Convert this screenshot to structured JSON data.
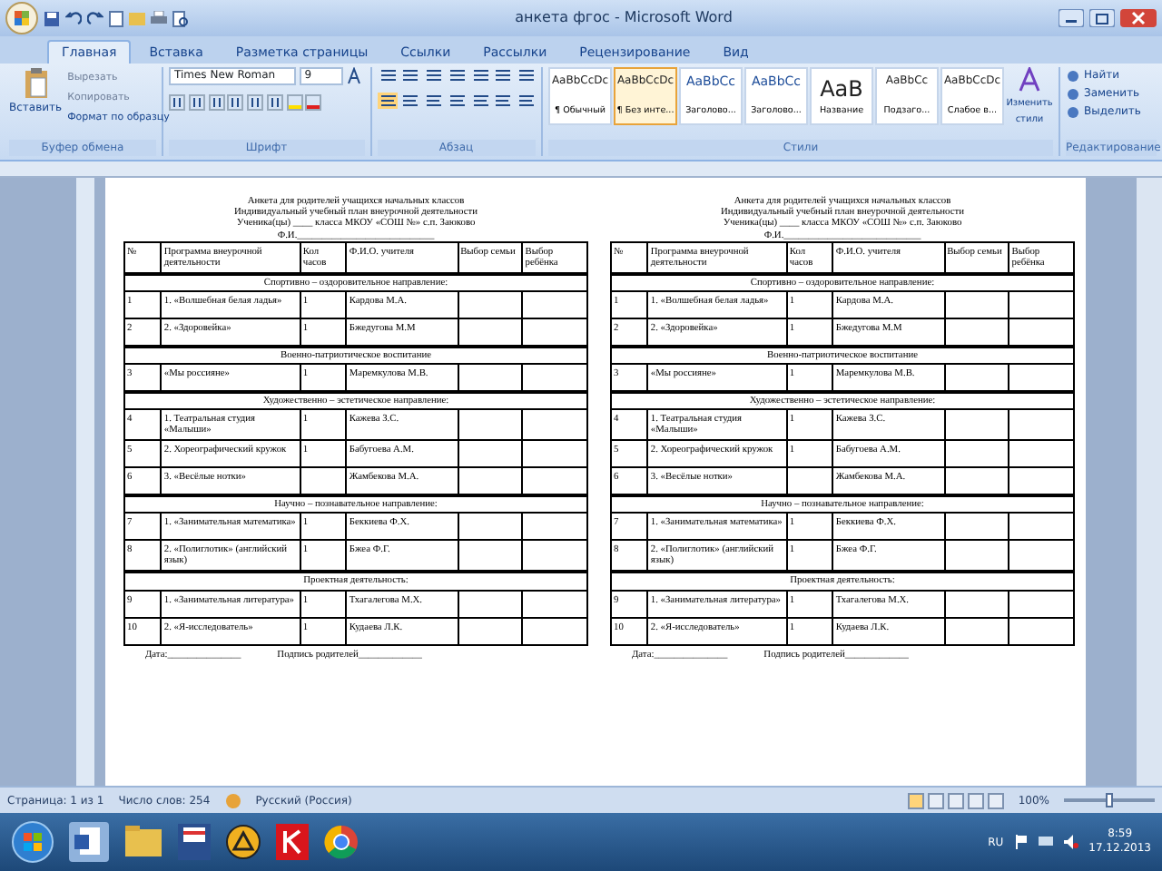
{
  "window": {
    "title": "анкета фгос - Microsoft Word"
  },
  "tabs": [
    {
      "label": "Главная",
      "selected": true
    },
    {
      "label": "Вставка",
      "selected": false
    },
    {
      "label": "Разметка страницы",
      "selected": false
    },
    {
      "label": "Ссылки",
      "selected": false
    },
    {
      "label": "Рассылки",
      "selected": false
    },
    {
      "label": "Рецензирование",
      "selected": false
    },
    {
      "label": "Вид",
      "selected": false
    }
  ],
  "ribbon": {
    "clipboard": {
      "paste": "Вставить",
      "items": [
        {
          "label": "Вырезать",
          "disabled": true
        },
        {
          "label": "Копировать",
          "disabled": true
        },
        {
          "label": "Формат по образцу",
          "disabled": false
        }
      ],
      "label": "Буфер обмена"
    },
    "font": {
      "name": "Times New Roman",
      "size": "9",
      "label": "Шрифт"
    },
    "paragraph": {
      "label": "Абзац"
    },
    "styles": {
      "items": [
        {
          "sample": "AaBbCcDc",
          "name": "¶ Обычный",
          "selected": false
        },
        {
          "sample": "AaBbCcDc",
          "name": "¶ Без инте...",
          "selected": true
        },
        {
          "sample": "AaBbCc",
          "name": "Заголово...",
          "selected": false
        },
        {
          "sample": "AaBbCc",
          "name": "Заголово...",
          "selected": false
        },
        {
          "sample": "АаВ",
          "name": "Название",
          "selected": false
        },
        {
          "sample": "AaBbCc",
          "name": "Подзаго...",
          "selected": false
        },
        {
          "sample": "AaBbCcDc",
          "name": "Слабое в...",
          "selected": false
        }
      ],
      "change": "Изменить стили",
      "label": "Стили"
    },
    "editing": {
      "items": [
        "Найти",
        "Заменить",
        "Выделить"
      ],
      "label": "Редактирование"
    }
  },
  "document": {
    "forms": [
      {
        "heading": [
          "Анкета для родителей учащихся начальных классов",
          "Индивидуальный учебный план внеурочной деятельности",
          "Ученика(цы) ____ класса МКОУ «СОШ №» с.п. Заюково",
          "Ф.И.____________________________"
        ],
        "columns": [
          "№",
          "Программа внеурочной деятельности",
          "Кол часов",
          "Ф.И.О. учителя",
          "Выбор семьи",
          "Выбор ребёнка"
        ],
        "sections": [
          {
            "title": "Спортивно – оздоровительное направление:",
            "rows": [
              {
                "number": "1",
                "program": "1. «Волшебная белая ладья»",
                "hours": "1",
                "teacher": "Кардова М.А."
              },
              {
                "number": "2",
                "program": "2. «Здоровейка»",
                "hours": "1",
                "teacher": "Бжедугова М.М"
              }
            ]
          },
          {
            "title": "Военно-патриотическое воспитание",
            "rows": [
              {
                "number": "3",
                "program": "«Мы россияне»",
                "hours": "1",
                "teacher": "Маремкулова М.В."
              }
            ]
          },
          {
            "title": "Художественно – эстетическое направление:",
            "rows": [
              {
                "number": "4",
                "program": "1. Театральная студия «Малыши»",
                "hours": "1",
                "teacher": "Кажева З.С."
              },
              {
                "number": "5",
                "program": "2. Хореографический кружок",
                "hours": "1",
                "teacher": "Бабугоева А.М."
              },
              {
                "number": "6",
                "program": "3. «Весёлые нотки»",
                "teacher": "Жамбекова М.А."
              }
            ]
          },
          {
            "title": "Научно – познавательное направление:",
            "rows": [
              {
                "number": "7",
                "program": "1. «Занимательная математика»",
                "hours": "1",
                "teacher": "Беккиева Ф.Х."
              },
              {
                "number": "8",
                "program": "2. «Полиглотик» (английский язык)",
                "hours": "1",
                "teacher": "Бжеа Ф.Г."
              }
            ]
          },
          {
            "title": "Проектная деятельность:",
            "rows": [
              {
                "number": "9",
                "program": "1. «Занимательная литература»",
                "hours": "1",
                "teacher": "Тхагалегова М.Х."
              },
              {
                "number": "10",
                "program": "2. «Я-исследователь»",
                "hours": "1",
                "teacher": "Кудаева Л.К."
              }
            ]
          }
        ],
        "footer": {
          "date": "Дата:_______________",
          "signature": "Подпись родителей_____________"
        }
      },
      {
        "heading": [
          "Анкета для родителей учащихся начальных классов",
          "Индивидуальный учебный план внеурочной деятельности",
          "Ученика(цы) ____ класса МКОУ «СОШ №» с.п. Заюково",
          "Ф.И.____________________________"
        ],
        "columns": [
          "№",
          "Программа внеурочной деятельности",
          "Кол часов",
          "Ф.И.О. учителя",
          "Выбор семьи",
          "Выбор ребёнка"
        ],
        "sections": [
          {
            "title": "Спортивно – оздоровительное направление:",
            "rows": [
              {
                "number": "1",
                "program": "1. «Волшебная белая ладья»",
                "hours": "1",
                "teacher": "Кардова М.А."
              },
              {
                "number": "2",
                "program": "2. «Здоровейка»",
                "hours": "1",
                "teacher": "Бжедугова М.М"
              }
            ]
          },
          {
            "title": "Военно-патриотическое воспитание",
            "rows": [
              {
                "number": "3",
                "program": "«Мы россияне»",
                "hours": "1",
                "teacher": "Маремкулова М.В."
              }
            ]
          },
          {
            "title": "Художественно – эстетическое направление:",
            "rows": [
              {
                "number": "4",
                "program": "1. Театральная студия «Малыши»",
                "hours": "1",
                "teacher": "Кажева З.С."
              },
              {
                "number": "5",
                "program": "2. Хореографический кружок",
                "hours": "1",
                "teacher": "Бабугоева А.М."
              },
              {
                "number": "6",
                "program": "3. «Весёлые нотки»",
                "teacher": "Жамбекова М.А."
              }
            ]
          },
          {
            "title": "Научно – познавательное направление:",
            "rows": [
              {
                "number": "7",
                "program": "1. «Занимательная математика»",
                "hours": "1",
                "teacher": "Беккиева Ф.Х."
              },
              {
                "number": "8",
                "program": "2. «Полиглотик» (английский язык)",
                "hours": "1",
                "teacher": "Бжеа Ф.Г."
              }
            ]
          },
          {
            "title": "Проектная деятельность:",
            "rows": [
              {
                "number": "9",
                "program": "1. «Занимательная литература»",
                "hours": "1",
                "teacher": "Тхагалегова М.Х."
              },
              {
                "number": "10",
                "program": "2. «Я-исследователь»",
                "hours": "1",
                "teacher": "Кудаева Л.К."
              }
            ]
          }
        ],
        "footer": {
          "date": "Дата:_______________",
          "signature": "Подпись родителей_____________"
        }
      }
    ]
  },
  "status_bar": {
    "page": "Страница: 1 из 1",
    "words": "Число слов: 254",
    "language": "Русский (Россия)",
    "zoom": "100%",
    "level": 0.45
  },
  "taskbar": {
    "language": "RU",
    "time": "8:59",
    "date": "17.12.2013"
  }
}
